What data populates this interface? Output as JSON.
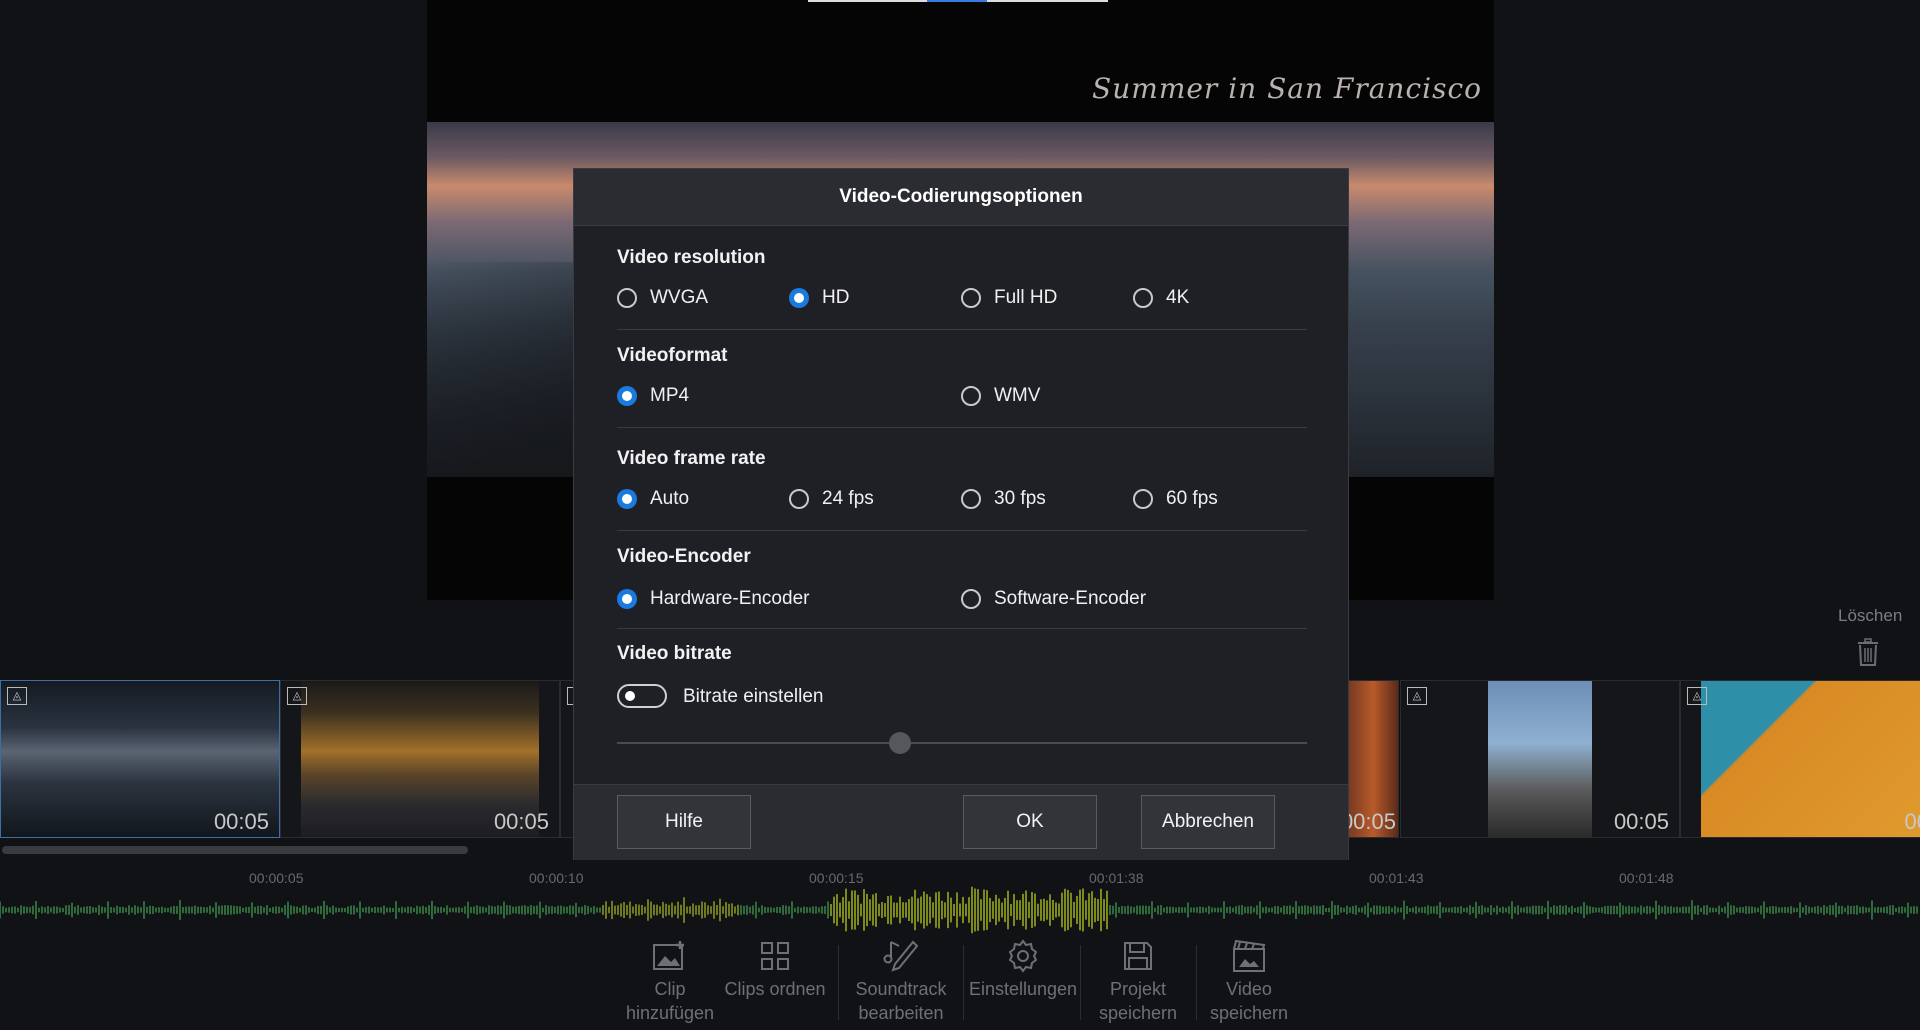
{
  "preview": {
    "overlay_title": "Summer in San Francisco"
  },
  "dialog": {
    "title": "Video-Codierungsoptionen",
    "sections": {
      "resolution": {
        "title": "Video resolution",
        "options": [
          "WVGA",
          "HD",
          "Full HD",
          "4K"
        ],
        "selected": "HD"
      },
      "format": {
        "title": "Videoformat",
        "options": [
          "MP4",
          "WMV"
        ],
        "selected": "MP4"
      },
      "framerate": {
        "title": "Video frame rate",
        "options": [
          "Auto",
          "24 fps",
          "30 fps",
          "60 fps"
        ],
        "selected": "Auto"
      },
      "encoder": {
        "title": "Video-Encoder",
        "options": [
          "Hardware-Encoder",
          "Software-Encoder"
        ],
        "selected": "Hardware-Encoder"
      },
      "bitrate": {
        "title": "Video bitrate",
        "toggle_label": "Bitrate einstellen",
        "toggle_on": false,
        "slider_level": 0.41
      }
    },
    "buttons": {
      "help": "Hilfe",
      "ok": "OK",
      "cancel": "Abbrechen"
    }
  },
  "clips": [
    {
      "duration": "00:05"
    },
    {
      "duration": "00:05"
    },
    {
      "duration": "00:05"
    },
    {
      "duration": "00:05"
    },
    {
      "duration": "00:05"
    },
    {
      "duration": "00"
    }
  ],
  "delete_label": "Löschen",
  "timeline": {
    "ticks": [
      "00:00:05",
      "00:00:10",
      "00:00:15",
      "00:01:38",
      "00:01:43",
      "00:01:48"
    ]
  },
  "toolbar": {
    "add_clip": "Clip hinzufügen",
    "arrange": "Clips ordnen",
    "soundtrack": "Soundtrack bearbeiten",
    "settings": "Einstellungen",
    "save_project": "Projekt speichern",
    "save_video": "Video speichern"
  },
  "colors": {
    "accent": "#1a7ae0",
    "background": "#111216",
    "dialog": "#1f2026"
  }
}
